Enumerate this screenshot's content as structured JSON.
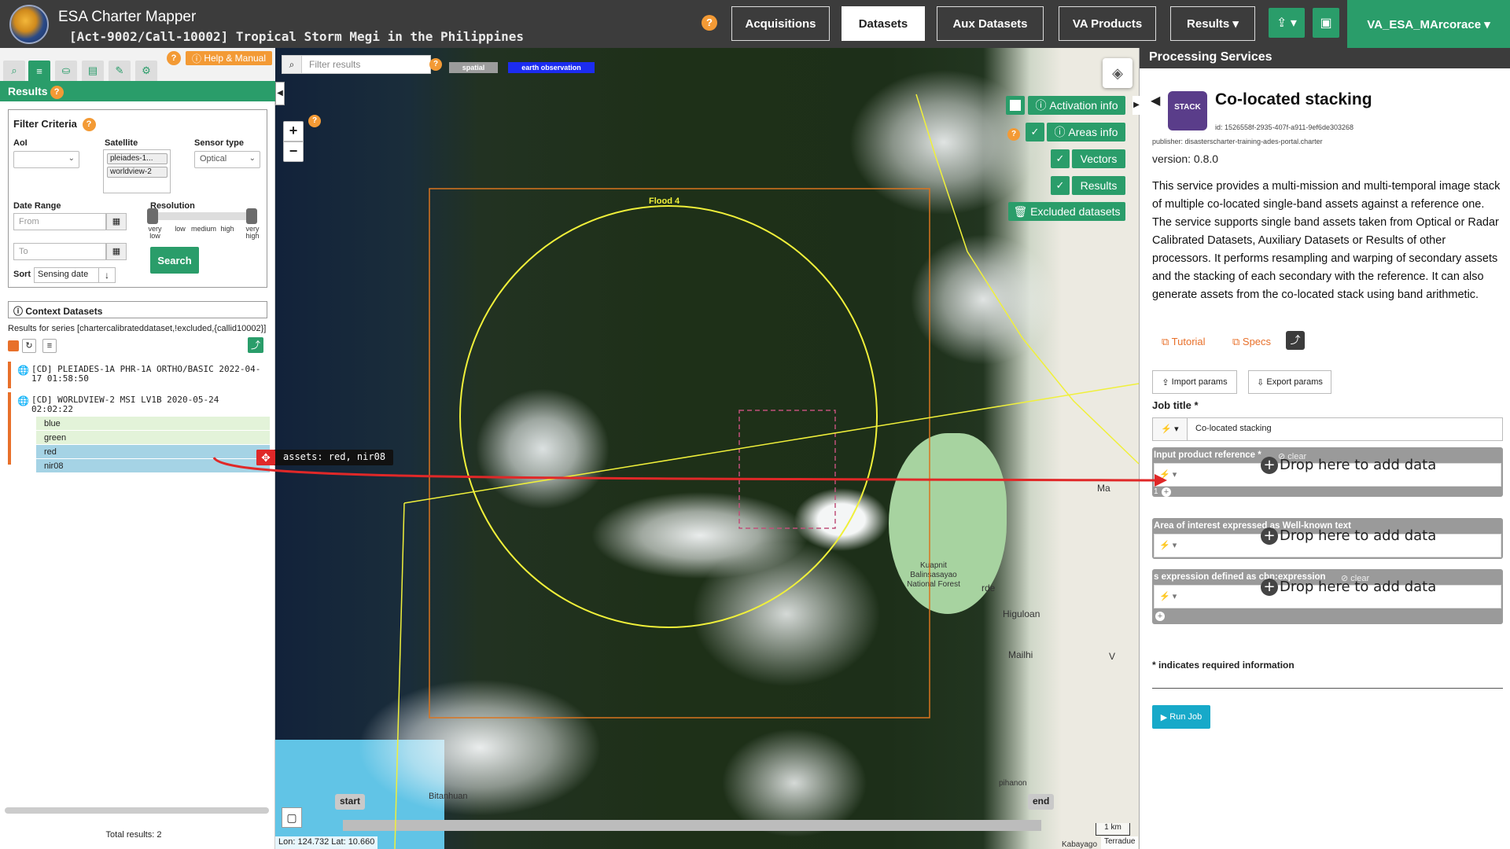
{
  "header": {
    "app_title": "ESA Charter Mapper",
    "activation_title": "[Act-9002/Call-10002] Tropical Storm Megi in the Philippines",
    "help": "?",
    "nav": [
      "Acquisitions",
      "Datasets",
      "Aux Datasets",
      "VA Products",
      "Results ▾"
    ],
    "active_nav": "Datasets",
    "user": "VA_ESA_MArcorace ▾"
  },
  "left": {
    "help_manual": "Help & Manual",
    "results_title": "Results",
    "filter": {
      "title": "Filter Criteria",
      "aoi_label": "AoI",
      "satellite_label": "Satellite",
      "satellite_tags": [
        "pleiades-1...",
        "worldview-2"
      ],
      "sensor_label": "Sensor type",
      "sensor_value": "Optical",
      "date_label": "Date Range",
      "from_placeholder": "From",
      "to_placeholder": "To",
      "resolution_label": "Resolution",
      "resolution_ticks": [
        "very low",
        "low",
        "medium",
        "high",
        "very high"
      ],
      "search": "Search",
      "sort_label": "Sort",
      "sort_value": "Sensing date"
    },
    "context_title": "Context Datasets",
    "series_text": "Results for series [chartercalibrateddataset,!excluded,{callid10002}]",
    "datasets": [
      {
        "label": "[CD] PLEIADES-1A PHR-1A ORTHO/BASIC 2022-04-17 01:58:50"
      },
      {
        "label": "[CD] WORLDVIEW-2 MSI LV1B 2020-05-24 02:02:22"
      }
    ],
    "bands": [
      "blue",
      "green",
      "red",
      "nir08"
    ],
    "total_results": "Total results: 2"
  },
  "drag": {
    "tooltip": "assets: red, nir08"
  },
  "map": {
    "filter_placeholder": "Filter results",
    "tags": [
      "spatial",
      "earth observation"
    ],
    "flood_label": "Flood 4",
    "layers": {
      "activation_info": "Activation info",
      "areas_info": "Areas info",
      "vectors": "Vectors",
      "results": "Results",
      "excluded": "Excluded datasets"
    },
    "timeline_start": "start",
    "timeline_end": "end",
    "scale": "1 km",
    "coords": "Lon: 124.732 Lat: 10.660",
    "attribution": "Terradue",
    "places": [
      "Bitanhuan",
      "Kuapnit Balinsasayao National Forest",
      "Higuloan",
      "Mailhi",
      "Ma",
      "rde",
      "V",
      "Kabayago",
      "pihanon"
    ],
    "tag_colors": {
      "spatial": "#9c9c9c",
      "earth_observation": "#1c2cf0"
    }
  },
  "right": {
    "title": "Processing Services",
    "service": {
      "name": "Co-located stacking",
      "logo_text": "STACK",
      "id": "id: 1526558f-2935-407f-a911-9ef6de303268",
      "publisher": "publisher: disasterscharter-training-ades-portal.charter",
      "version": "version: 0.8.0",
      "description": "This service provides a multi-mission and multi-temporal image stack of multiple co-located single-band assets against a reference one. The service supports single band assets taken from Optical or Radar Calibrated Datasets, Auxiliary Datasets or Results of other processors. It performs resampling and warping of secondary assets and the stacking of each secondary with the reference. It can also generate assets from the co-located stack using band arithmetic.",
      "tutorial": "Tutorial",
      "specs": "Specs"
    },
    "import_params": "Import params",
    "export_params": "Export params",
    "job_title_label": "Job title *",
    "job_title_value": "Co-located stacking",
    "params": [
      {
        "label": "Input product reference *",
        "clear": "clear",
        "drop": "Drop here to add data",
        "count": "1"
      },
      {
        "label": "Area of interest expressed as Well-known text",
        "drop": "Drop here to add data"
      },
      {
        "label": "s expression defined as cbn:expression",
        "clear": "clear",
        "drop": "Drop here to add data"
      }
    ],
    "required_note": "* indicates required information",
    "run_job": "Run Job"
  },
  "colors": {
    "accent_green": "#2a9d6a",
    "header_dark": "#3c3c3c",
    "orange": "#f39a35",
    "run_blue": "#17a9c9",
    "drag_arrow": "#e02828",
    "flood_yellow": "#f0f03a",
    "footprint_orange": "#d9741f"
  }
}
